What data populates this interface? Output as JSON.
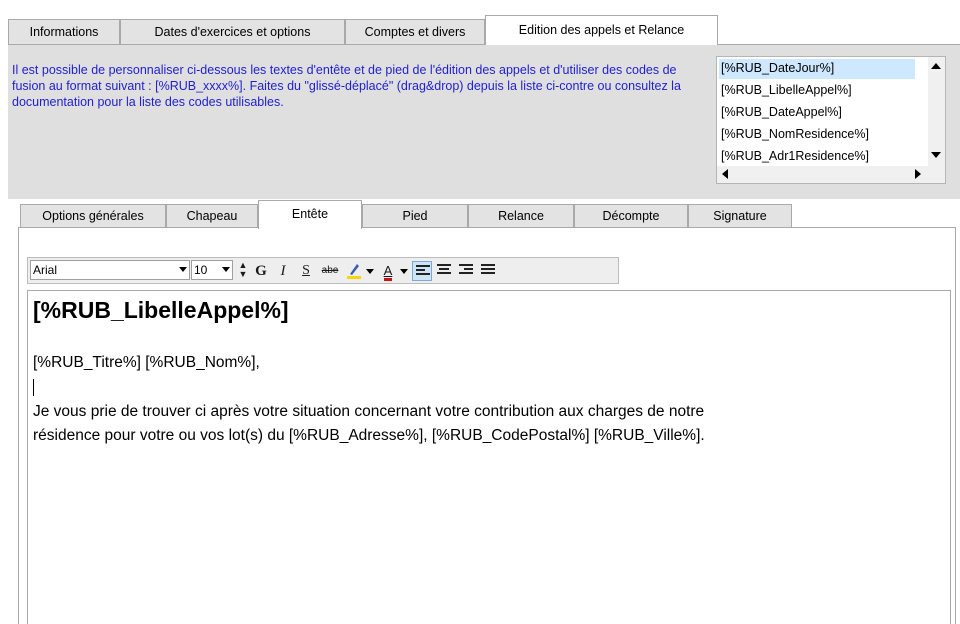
{
  "top_tabs": [
    {
      "label": "Informations"
    },
    {
      "label": "Dates d'exercices et options"
    },
    {
      "label": "Comptes et divers"
    },
    {
      "label": "Edition des appels et Relance",
      "active": true
    }
  ],
  "info_text": "Il est possible de personnaliser ci-dessous les textes d'entête et de pied de l'édition des appels et d'utiliser des codes de fusion au format suivant : [%RUB_xxxx%]. Faites du \"glissé-déplacé\" (drag&drop) depuis la liste ci-contre ou consultez la documentation pour la liste des codes utilisables.",
  "merge_codes": {
    "items": [
      "[%RUB_DateJour%]",
      "[%RUB_LibelleAppel%]",
      "[%RUB_DateAppel%]",
      "[%RUB_NomResidence%]",
      "[%RUB_Adr1Residence%]"
    ],
    "selected_index": 0
  },
  "inner_tabs": [
    {
      "label": "Options générales"
    },
    {
      "label": "Chapeau"
    },
    {
      "label": "Entête",
      "active": true
    },
    {
      "label": "Pied"
    },
    {
      "label": "Relance"
    },
    {
      "label": "Décompte"
    },
    {
      "label": "Signature"
    }
  ],
  "toolbar": {
    "font_name": "Arial",
    "font_size": "10",
    "bold_label": "G",
    "italic_label": "I",
    "underline_label": "S",
    "strike_label": "abe",
    "font_color_label": "A",
    "icons": {
      "spin": "spin-updown-icon",
      "highlight": "highlighter-icon",
      "align_left": "align-left-icon",
      "align_center": "align-center-icon",
      "align_right": "align-right-icon",
      "justify": "align-justify-icon"
    },
    "colors": {
      "highlight": "#f4d60a",
      "font": "#d01010",
      "accent": "#3c6fbf"
    }
  },
  "document": {
    "title": "[%RUB_LibelleAppel%]",
    "greeting": "[%RUB_Titre%] [%RUB_Nom%],",
    "body_line1": "Je vous prie de trouver ci après votre situation concernant votre contribution aux charges de notre",
    "body_line2": "résidence pour votre ou vos lot(s) du [%RUB_Adresse%], [%RUB_CodePostal%] [%RUB_Ville%]."
  }
}
